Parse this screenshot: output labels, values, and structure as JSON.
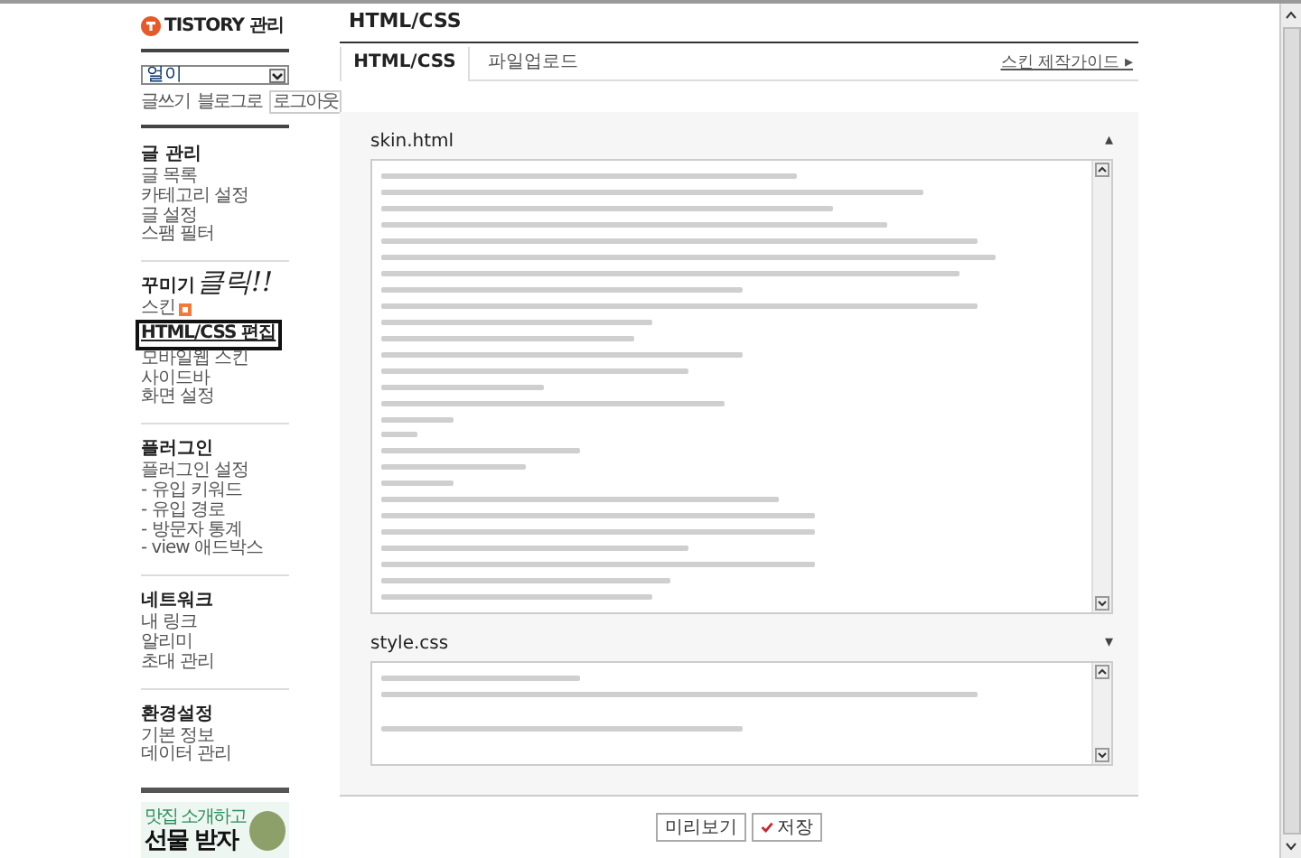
{
  "sidebar": {
    "logo": "TISTORY 관리",
    "blog_select": {
      "value": "얼이"
    },
    "links": [
      "글쓰기",
      "블로그로",
      "로그아웃"
    ],
    "sections": [
      {
        "title": "글 관리",
        "items": [
          {
            "label": "글 목록",
            "selected": false,
            "new": false
          },
          {
            "label": "카테고리 설정",
            "selected": false,
            "new": false
          },
          {
            "label": "글 설정",
            "selected": false,
            "new": false
          },
          {
            "label": "스팸 필터",
            "selected": false,
            "new": false
          }
        ]
      },
      {
        "title": "꾸미기",
        "items": [
          {
            "label": "스킨",
            "selected": false,
            "new": true
          },
          {
            "label": "HTML/CSS 편집",
            "selected": true,
            "new": false
          },
          {
            "label": "모바일웹 스킨",
            "selected": false,
            "new": false
          },
          {
            "label": "사이드바",
            "selected": false,
            "new": false
          },
          {
            "label": "화면 설정",
            "selected": false,
            "new": false
          }
        ]
      },
      {
        "title": "플러그인",
        "items": [
          {
            "label": "플러그인 설정",
            "selected": false,
            "new": false
          },
          {
            "label": "- 유입 키워드",
            "selected": false,
            "new": false
          },
          {
            "label": "- 유입 경로",
            "selected": false,
            "new": false
          },
          {
            "label": "- 방문자 통계",
            "selected": false,
            "new": false
          },
          {
            "label": "- view 애드박스",
            "selected": false,
            "new": false
          }
        ]
      },
      {
        "title": "네트워크",
        "items": [
          {
            "label": "내 링크",
            "selected": false,
            "new": false
          },
          {
            "label": "알리미",
            "selected": false,
            "new": false
          },
          {
            "label": "초대 관리",
            "selected": false,
            "new": false
          }
        ]
      },
      {
        "title": "환경설정",
        "items": [
          {
            "label": "기본 정보",
            "selected": false,
            "new": false
          },
          {
            "label": "데이터 관리",
            "selected": false,
            "new": false
          }
        ]
      }
    ],
    "annotation": "클릭!!",
    "banner": {
      "line_1": "맛집 소개하고",
      "line_2": "선물 받자"
    }
  },
  "main": {
    "title": "HTML/CSS",
    "tabs": [
      {
        "label": "HTML/CSS",
        "selected": true
      },
      {
        "label": "파일업로드",
        "selected": false
      }
    ],
    "guide_link": "스킨 제작가이드 ▸",
    "editors": [
      {
        "label": "skin.html",
        "toggle": "▴",
        "kind": "large"
      },
      {
        "label": "style.css",
        "toggle": "▾",
        "kind": "small"
      }
    ],
    "buttons": [
      {
        "label": "미리보기",
        "kind": "plain"
      },
      {
        "label": "저장",
        "kind": "save"
      }
    ]
  }
}
